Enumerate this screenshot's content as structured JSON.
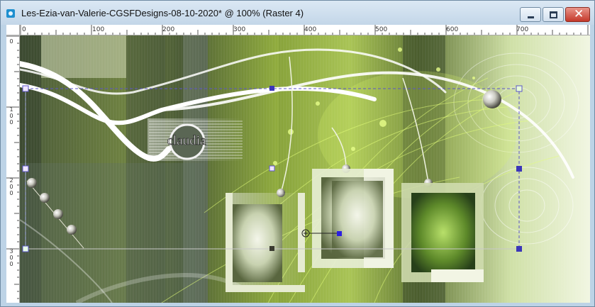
{
  "window": {
    "title": "Les-Ezia-van-Valerie-CGSFDesigns-08-10-2020* @ 100% (Raster 4)",
    "controls": {
      "minimize": "minimize",
      "maximize": "maximize",
      "close": "✕"
    }
  },
  "ruler": {
    "horizontal": [
      "0",
      "100",
      "200",
      "300",
      "400",
      "500",
      "600",
      "700"
    ],
    "vertical": [
      "0",
      "1",
      "100",
      "200",
      "300"
    ]
  },
  "canvas": {
    "logo_text": "claudia",
    "colors": {
      "dark_olive": "#3b4a30",
      "lime": "#a9c455",
      "pale": "#f1f6e2",
      "selection": "#5b55c8"
    }
  }
}
